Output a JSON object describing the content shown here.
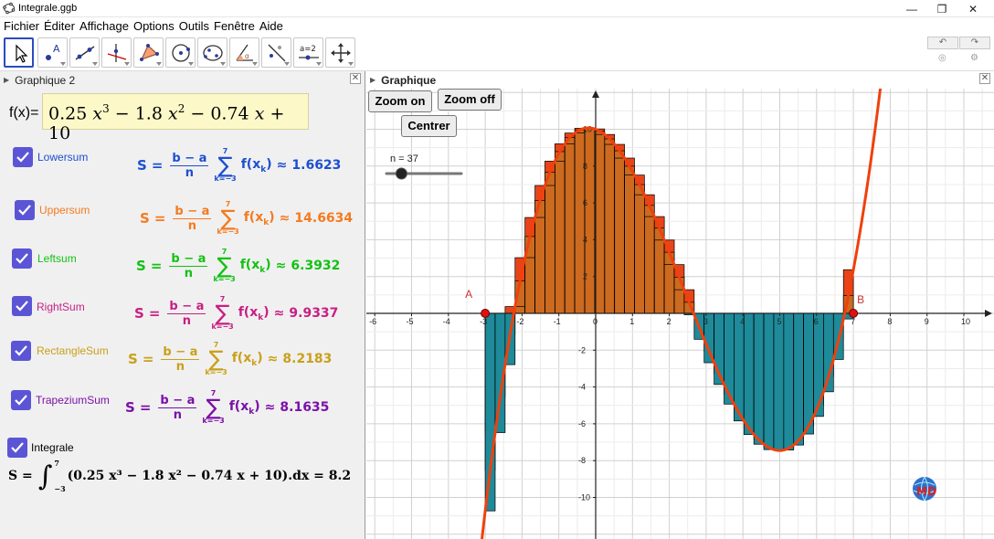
{
  "window": {
    "title": "Integrale.ggb",
    "controls": [
      "—",
      "❐",
      "✕"
    ]
  },
  "menu": [
    "Fichier",
    "Éditer",
    "Affichage",
    "Options",
    "Outils",
    "Fenêtre",
    "Aide"
  ],
  "toolbar": {
    "tools": [
      "move-tool",
      "point-tool",
      "line-tool",
      "perpendicular-tool",
      "polygon-tool",
      "circle-tool",
      "conic-tool",
      "angle-tool",
      "reflect-tool",
      "slider-tool",
      "move-view-tool"
    ],
    "slider_tool_text": "a=2",
    "undo": "↶",
    "redo": "↷"
  },
  "left_panel": {
    "title": "Graphique 2",
    "fx_label": "f(x)=",
    "function_parts": {
      "c3": "0.25",
      "e3": "3",
      "c2": "1.8",
      "e2": "2",
      "c1": "0.74",
      "c0": "10"
    },
    "sums": [
      {
        "name": "Lowersum",
        "color": "#1d4fd1",
        "value": "1.6623"
      },
      {
        "name": "Uppersum",
        "color": "#f47a20",
        "value": "14.6634"
      },
      {
        "name": "Leftsum",
        "color": "#12c212",
        "value": "6.3932"
      },
      {
        "name": "RightSum",
        "color": "#c81f84",
        "value": "9.9337"
      },
      {
        "name": "RectangleSum",
        "color": "#c9a01a",
        "value": "8.2183"
      },
      {
        "name": "TrapeziumSum",
        "color": "#7b10a8",
        "value": "8.1635"
      }
    ],
    "formula_text": {
      "S": "S",
      "eq": "=",
      "num": "b − a",
      "den": "n",
      "upper": "7",
      "lower": "k=−3",
      "sigma": "∑",
      "fx": "f(x",
      "sub": "k",
      "close": ")",
      "approx": "≈"
    },
    "integrale_label": "Integrale",
    "integral": {
      "prefix": "S =",
      "upper": "7",
      "lower": "−3",
      "body": "(0.25 x³ − 1.8 x² − 0.74 x + 10).dx = 8.2"
    }
  },
  "right_panel": {
    "title": "Graphique",
    "buttons": {
      "zoom_in": "Zoom on",
      "zoom_out": "Zoom off",
      "center": "Centrer"
    },
    "slider": {
      "label": "n = 37",
      "value": 37,
      "fraction": 0.2
    },
    "points": {
      "A": "A",
      "B": "B"
    }
  },
  "chart_data": {
    "type": "line",
    "function": "0.25x^3 - 1.8x^2 - 0.74x + 10",
    "coefficients": [
      0.25,
      -1.8,
      -0.74,
      10
    ],
    "interval": [
      -3,
      7
    ],
    "n": 37,
    "xlim": [
      -6.5,
      10.5
    ],
    "ylim": [
      -12,
      12
    ],
    "x_ticks": [
      -6,
      -5,
      -4,
      -3,
      -2,
      -1,
      0,
      1,
      2,
      3,
      4,
      5,
      6,
      7,
      8,
      9,
      10
    ],
    "y_ticks": [
      -10,
      -8,
      -6,
      -4,
      -2,
      2,
      4,
      6,
      8,
      10
    ],
    "grid": true,
    "colors": {
      "curve": "#f0400c",
      "fill": "#cc6a1f",
      "upper": "#e8441a",
      "lower": "#1e8a9a",
      "stroke": "#000000",
      "point": "#e01010"
    }
  }
}
